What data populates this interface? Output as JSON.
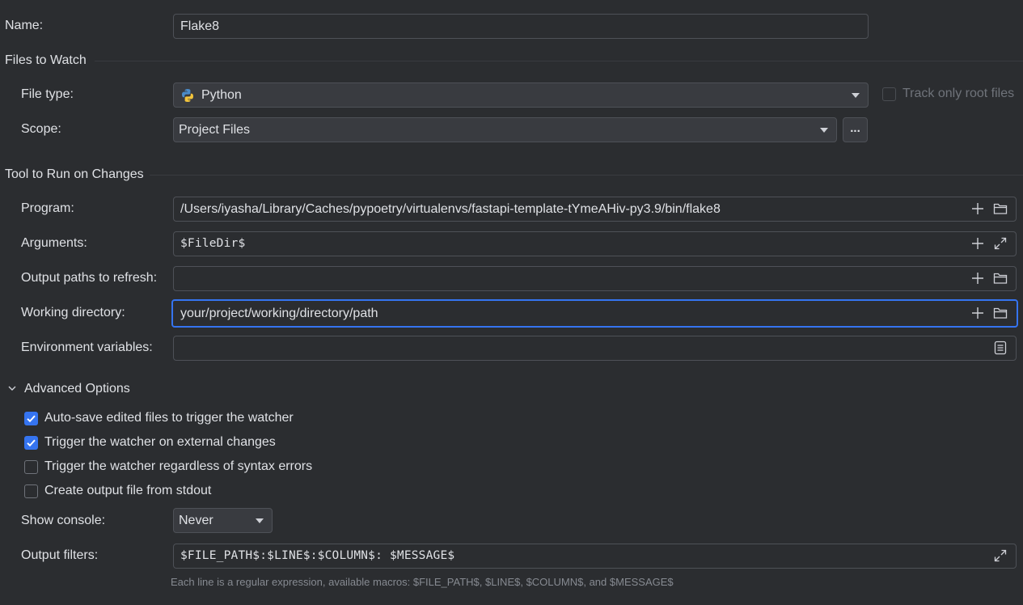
{
  "name": {
    "label": "Name:",
    "value": "Flake8"
  },
  "files_to_watch": {
    "title": "Files to Watch",
    "file_type": {
      "label": "File type:",
      "value": "Python",
      "icon": "python-icon"
    },
    "track_root": {
      "label": "Track only root files",
      "checked": false,
      "enabled": false
    },
    "scope": {
      "label": "Scope:",
      "value": "Project Files",
      "more_label": "..."
    }
  },
  "tool": {
    "title": "Tool to Run on Changes",
    "program": {
      "label": "Program:",
      "value": "/Users/iyasha/Library/Caches/pypoetry/virtualenvs/fastapi-template-tYmeAHiv-py3.9/bin/flake8"
    },
    "arguments": {
      "label": "Arguments:",
      "value": "$FileDir$"
    },
    "output_paths": {
      "label": "Output paths to refresh:",
      "value": ""
    },
    "working_dir": {
      "label": "Working directory:",
      "value": "your/project/working/directory/path"
    },
    "env_vars": {
      "label": "Environment variables:",
      "value": ""
    }
  },
  "advanced": {
    "title": "Advanced Options",
    "expanded": true,
    "options": [
      {
        "label": "Auto-save edited files to trigger the watcher",
        "checked": true
      },
      {
        "label": "Trigger the watcher on external changes",
        "checked": true
      },
      {
        "label": "Trigger the watcher regardless of syntax errors",
        "checked": false
      },
      {
        "label": "Create output file from stdout",
        "checked": false
      }
    ],
    "show_console": {
      "label": "Show console:",
      "value": "Never"
    },
    "output_filters": {
      "label": "Output filters:",
      "value": "$FILE_PATH$:$LINE$:$COLUMN$: $MESSAGE$",
      "hint": "Each line is a regular expression, available macros: $FILE_PATH$, $LINE$, $COLUMN$, and $MESSAGE$"
    }
  },
  "colors": {
    "background": "#2b2d30",
    "accent": "#3574f0",
    "text": "#dfe1e5",
    "border": "#4e5157"
  }
}
